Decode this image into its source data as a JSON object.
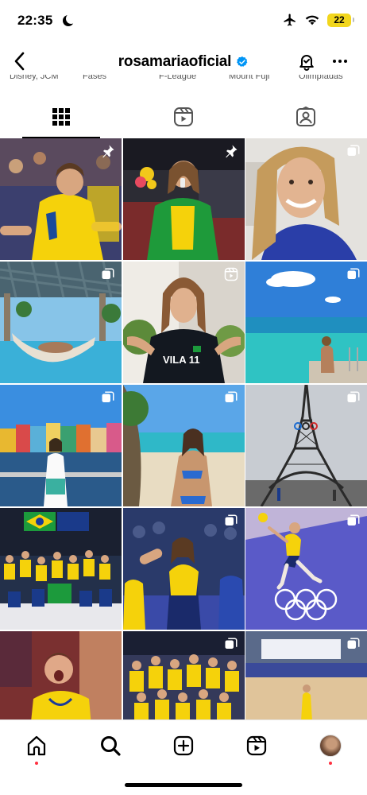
{
  "status_bar": {
    "time": "22:35",
    "battery": "22",
    "icons": [
      "moon-icon",
      "airplane-icon",
      "wifi-icon",
      "battery-icon"
    ]
  },
  "header": {
    "username": "rosamariaoficial",
    "verified": true,
    "icons": [
      "back-chevron-icon",
      "verified-badge-icon",
      "notification-bell-icon",
      "more-options-icon"
    ]
  },
  "highlights": {
    "labels": [
      "Disney, JCM",
      "Fases",
      "F-League",
      "Mount Fuji",
      "Olimpíadas"
    ]
  },
  "tabs": [
    {
      "name": "posts",
      "icon": "grid-icon",
      "active": true
    },
    {
      "name": "reels",
      "icon": "reels-icon",
      "active": false
    },
    {
      "name": "tagged",
      "icon": "tagged-icon",
      "active": false
    }
  ],
  "posts": [
    {
      "badge": "pin-icon",
      "scene": "player-yellow-jersey-7"
    },
    {
      "badge": "pin-icon",
      "scene": "podium-green-jacket-flowers"
    },
    {
      "badge": "carousel-icon",
      "scene": "selfie-smile-blue-shirt"
    },
    {
      "badge": "carousel-icon",
      "scene": "hammock-pool-pergola"
    },
    {
      "badge": "reel-icon",
      "scene": "portrait-vila11-shirt"
    },
    {
      "badge": "carousel-icon",
      "scene": "beach-turquoise-sea"
    },
    {
      "badge": "carousel-icon",
      "scene": "colorful-waterfront-houses"
    },
    {
      "badge": "carousel-icon",
      "scene": "beach-bikini-tree"
    },
    {
      "badge": "carousel-icon",
      "scene": "eiffel-tower"
    },
    {
      "badge": "none",
      "scene": "team-celebration-flags"
    },
    {
      "badge": "carousel-icon",
      "scene": "match-action-crowd"
    },
    {
      "badge": "carousel-icon",
      "scene": "spike-on-purple-court"
    },
    {
      "badge": "none",
      "scene": "player-shouting-yellow-7"
    },
    {
      "badge": "carousel-icon",
      "scene": "team-group-yellow"
    },
    {
      "badge": "carousel-icon",
      "scene": "paris-2024-arena"
    }
  ],
  "bottom_nav": [
    {
      "name": "home",
      "icon": "home-icon",
      "dot": true
    },
    {
      "name": "search",
      "icon": "search-icon",
      "dot": false
    },
    {
      "name": "create",
      "icon": "create-post-icon",
      "dot": false
    },
    {
      "name": "reels",
      "icon": "reels-nav-icon",
      "dot": false
    },
    {
      "name": "profile",
      "icon": "profile-avatar",
      "dot": true
    }
  ],
  "colors": {
    "accent_blue": "#0095f6",
    "notification_red": "#ff3040",
    "battery_yellow": "#f2d61d"
  }
}
